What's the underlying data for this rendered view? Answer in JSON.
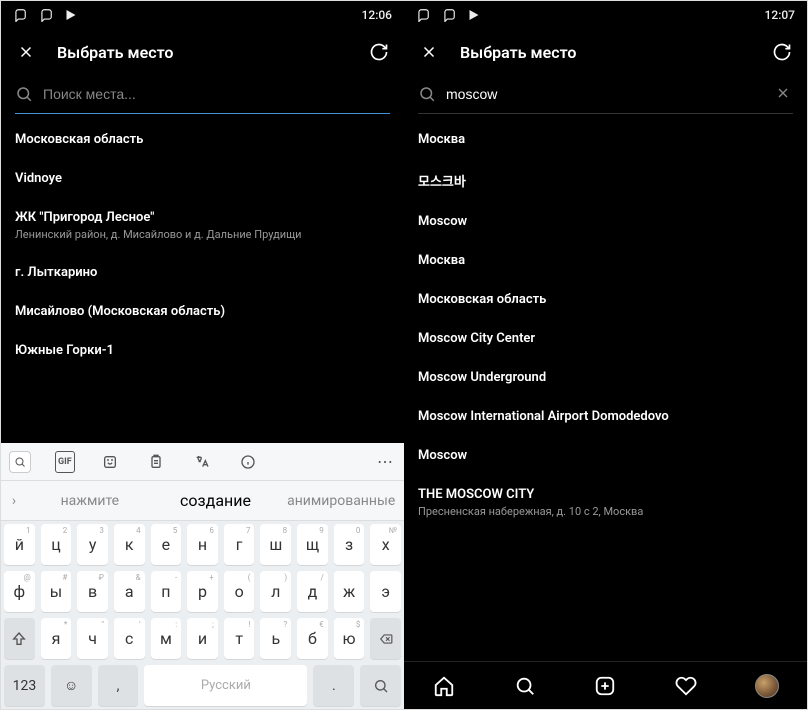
{
  "left": {
    "status_time": "12:06",
    "header_title": "Выбрать место",
    "search_placeholder": "Поиск места...",
    "search_value": "",
    "suggestions": {
      "left": "нажмите",
      "main": "создание",
      "right": "анимированные"
    },
    "keyboard_lang": "Русский",
    "keyboard_num_label": "123",
    "results": [
      {
        "title": "Московская область",
        "sub": ""
      },
      {
        "title": "Vidnoye",
        "sub": ""
      },
      {
        "title": "ЖК \"Пригород Лесное\"",
        "sub": "Ленинский район, д. Мисайлово и д. Дальние Прудищи"
      },
      {
        "title": "г. Лыткарино",
        "sub": ""
      },
      {
        "title": "Мисайлово (Московская область)",
        "sub": ""
      },
      {
        "title": "Южные Горки-1",
        "sub": ""
      }
    ],
    "kb_row1": [
      {
        "main": "й",
        "sup": "1"
      },
      {
        "main": "ц",
        "sup": "2"
      },
      {
        "main": "у",
        "sup": "3"
      },
      {
        "main": "к",
        "sup": "4"
      },
      {
        "main": "е",
        "sup": "5"
      },
      {
        "main": "н",
        "sup": "6"
      },
      {
        "main": "г",
        "sup": "7"
      },
      {
        "main": "ш",
        "sup": "8"
      },
      {
        "main": "щ",
        "sup": "9"
      },
      {
        "main": "з",
        "sup": "0"
      },
      {
        "main": "х",
        "sup": "№"
      }
    ],
    "kb_row2": [
      {
        "main": "ф",
        "sup": "@"
      },
      {
        "main": "ы",
        "sup": "#"
      },
      {
        "main": "в",
        "sup": "₽"
      },
      {
        "main": "а",
        "sup": "&"
      },
      {
        "main": "п",
        "sup": "-"
      },
      {
        "main": "р",
        "sup": "+"
      },
      {
        "main": "о",
        "sup": "("
      },
      {
        "main": "л",
        "sup": ")"
      },
      {
        "main": "д",
        "sup": "/"
      },
      {
        "main": "ж",
        "sup": ""
      },
      {
        "main": "э",
        "sup": ""
      }
    ],
    "kb_row3": [
      {
        "main": "я",
        "sup": "*"
      },
      {
        "main": "ч",
        "sup": "\""
      },
      {
        "main": "с",
        "sup": "'"
      },
      {
        "main": "м",
        "sup": ":"
      },
      {
        "main": "и",
        "sup": ";"
      },
      {
        "main": "т",
        "sup": "!"
      },
      {
        "main": "ь",
        "sup": "?"
      },
      {
        "main": "б",
        "sup": "€"
      },
      {
        "main": "ю",
        "sup": "$"
      }
    ]
  },
  "right": {
    "status_time": "12:07",
    "header_title": "Выбрать место",
    "search_value": "moscow",
    "results": [
      {
        "title": "Москва",
        "sub": ""
      },
      {
        "title": "모스크바",
        "sub": ""
      },
      {
        "title": "Moscow",
        "sub": ""
      },
      {
        "title": "Москва",
        "sub": ""
      },
      {
        "title": "Московская область",
        "sub": ""
      },
      {
        "title": "Moscow City Center",
        "sub": ""
      },
      {
        "title": "Moscow Underground",
        "sub": ""
      },
      {
        "title": "Moscow International Airport Domodedovo",
        "sub": ""
      },
      {
        "title": "Moscow",
        "sub": ""
      },
      {
        "title": "THE MOSCOW CITY",
        "sub": "Пресненская набережная, д. 10 с 2, Москва"
      }
    ]
  }
}
